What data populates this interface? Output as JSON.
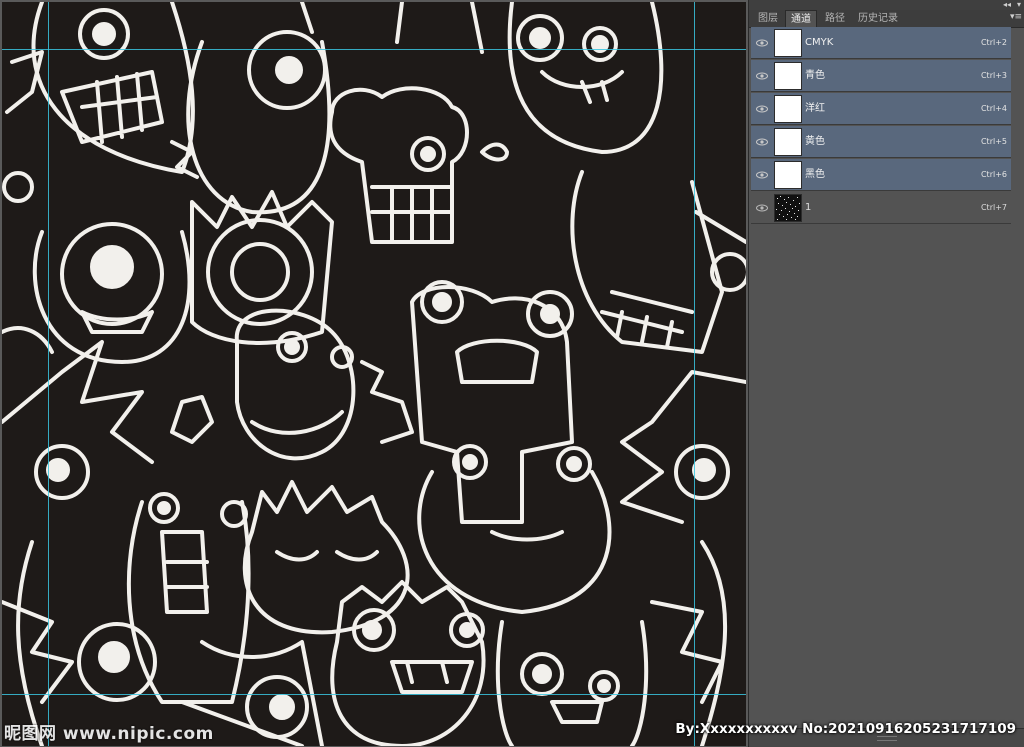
{
  "panel": {
    "tabs": [
      {
        "label": "图层",
        "active": false
      },
      {
        "label": "通道",
        "active": true
      },
      {
        "label": "路径",
        "active": false
      },
      {
        "label": "历史记录",
        "active": false
      }
    ],
    "collapse_icon": "double-chevron-left",
    "menu_icon": "panel-menu",
    "channels": [
      {
        "name": "CMYK",
        "shortcut": "Ctrl+2",
        "selected": true,
        "thumbnail": "white"
      },
      {
        "name": "青色",
        "shortcut": "Ctrl+3",
        "selected": true,
        "thumbnail": "white"
      },
      {
        "name": "洋红",
        "shortcut": "Ctrl+4",
        "selected": true,
        "thumbnail": "white"
      },
      {
        "name": "黄色",
        "shortcut": "Ctrl+5",
        "selected": true,
        "thumbnail": "white"
      },
      {
        "name": "黑色",
        "shortcut": "Ctrl+6",
        "selected": true,
        "thumbnail": "white"
      },
      {
        "name": "1",
        "shortcut": "Ctrl+7",
        "selected": false,
        "thumbnail": "noise"
      }
    ]
  },
  "watermark": {
    "left": "昵图网 www.nipic.com",
    "right": "By:Xxxxxxxxxxv No:20210916205231717109"
  },
  "colors": {
    "selected_row": "#59687d",
    "panel_bg": "#535353",
    "canvas_bg": "#1e1a18",
    "guide": "#39c6e0"
  }
}
